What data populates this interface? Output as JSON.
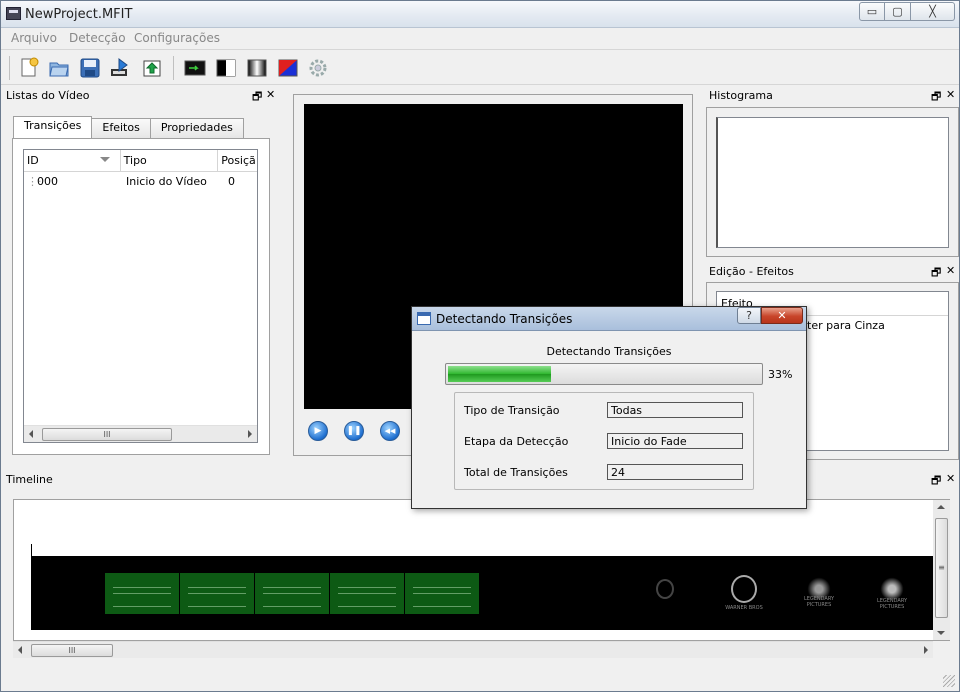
{
  "window": {
    "title": "NewProject.MFIT",
    "min": "▭",
    "max": "▢",
    "close": "╳"
  },
  "menu": {
    "arquivo": "Arquivo",
    "deteccao": "Detecção",
    "configuracoes": "Configurações"
  },
  "lists_dock": {
    "title": "Listas do Vídeo",
    "float": "🗗",
    "close": "✕",
    "tabs": [
      "Transições",
      "Efeitos",
      "Propriedades"
    ],
    "columns": [
      "ID",
      "Tipo",
      "Posiçã"
    ],
    "rows": [
      {
        "id": "000",
        "tipo": "Inicio do Vídeo",
        "posicao": "0"
      }
    ],
    "scroll_grip": "III"
  },
  "player": {
    "play": "▶",
    "pause": "❚❚",
    "rewind": "◀◀"
  },
  "histogram_dock": {
    "title": "Histograma",
    "float": "🗗",
    "close": "✕"
  },
  "effects_dock": {
    "title": "Edição - Efeitos",
    "float": "🗗",
    "close": "✕",
    "column": "Efeito",
    "item": "ter para Cinza"
  },
  "timeline_dock": {
    "title": "Timeline",
    "float": "🗗",
    "close": "✕",
    "scroll_grip": "III",
    "vscroll_grip": "≡"
  },
  "dialog": {
    "title": "Detectando Transições",
    "help": "?",
    "close": "✕",
    "label": "Detectando Transições",
    "progress_percent": 33,
    "progress_text": "33%",
    "fields": [
      {
        "label": "Tipo de Transição",
        "value": "Todas"
      },
      {
        "label": "Etapa da Detecção",
        "value": "Inicio do Fade"
      },
      {
        "label": "Total de Transições",
        "value": "24"
      }
    ]
  },
  "logos": {
    "wb": "WARNER BROS",
    "legendary1": "LEGENDARY PICTURES",
    "legendary2": "LEGENDARY PICTURES"
  },
  "colors": {
    "accent": "#1f6fd0",
    "progress": "#2fb82f",
    "close": "#c8452a"
  }
}
